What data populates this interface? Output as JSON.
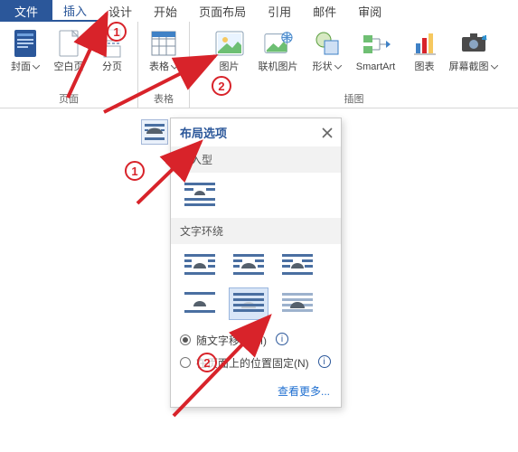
{
  "colors": {
    "accent": "#2b579a",
    "danger": "#d8232a",
    "link": "#1f6fd0"
  },
  "tabs": {
    "file": "文件",
    "insert": "插入",
    "design": "设计",
    "home": "开始",
    "layout": "页面布局",
    "refer": "引用",
    "mail": "邮件",
    "review": "审阅"
  },
  "groups": {
    "pages": {
      "label": "页面",
      "cover": "封面",
      "blank": "空白页",
      "break": "分页"
    },
    "tables": {
      "label": "表格",
      "table": "表格"
    },
    "illus": {
      "label": "插图",
      "picture": "图片",
      "online_pic": "联机图片",
      "shapes": "形状",
      "smartart": "SmartArt",
      "chart": "图表",
      "screenshot": "屏幕截图"
    }
  },
  "popover": {
    "title": "布局选项",
    "inline_label": "嵌入型",
    "wrap_label": "文字环绕",
    "options": {
      "inline": "inline",
      "square": "square",
      "tight": "tight",
      "through": "through",
      "topbot": "top-and-bottom",
      "behind": "behind-text",
      "front": "in-front-of-text"
    },
    "radios": {
      "move_with_text": "随文字移动(M)",
      "fix_on_page": "在页面上的位置固定(N)"
    },
    "see_more": "查看更多..."
  },
  "callouts": {
    "one": "1",
    "two": "2"
  }
}
